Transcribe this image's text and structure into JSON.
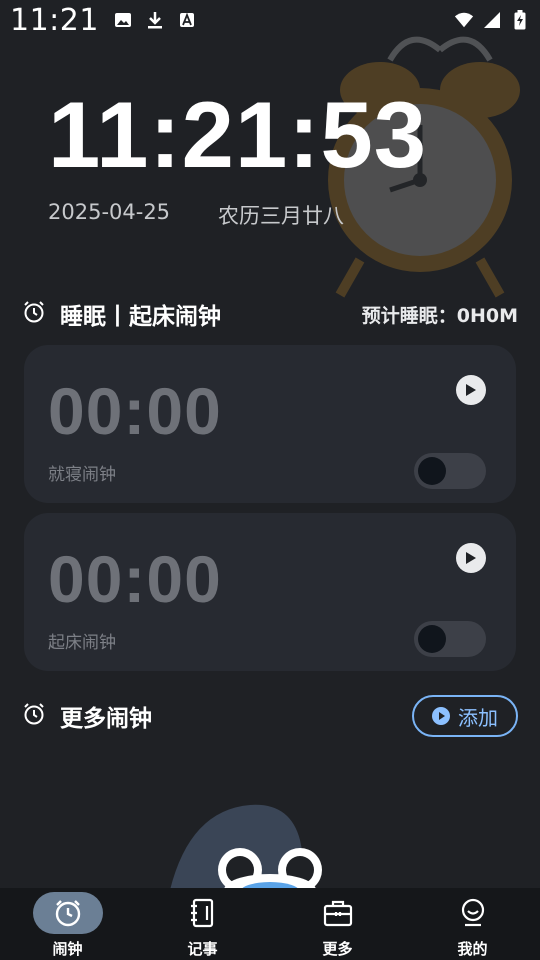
{
  "status_bar": {
    "time": "11:21",
    "left_icons": [
      "image-icon",
      "download-icon",
      "font-icon"
    ],
    "right_icons": [
      "wifi-icon",
      "signal-icon",
      "battery-icon"
    ]
  },
  "clock": {
    "time": "11:21:53",
    "date": "2025-04-25",
    "lunar": "农历三月廿八"
  },
  "sleep_section": {
    "title": "睡眠丨起床闹钟",
    "estimate": "预计睡眠：0H0M",
    "cards": [
      {
        "time": "00:00",
        "label": "就寝闹钟",
        "enabled": false
      },
      {
        "time": "00:00",
        "label": "起床闹钟",
        "enabled": false
      }
    ]
  },
  "more_section": {
    "title": "更多闹钟",
    "add_label": "添加"
  },
  "tabs": [
    {
      "label": "闹钟",
      "icon": "alarm-icon",
      "active": true
    },
    {
      "label": "记事",
      "icon": "notebook-icon",
      "active": false
    },
    {
      "label": "更多",
      "icon": "toolbox-icon",
      "active": false
    },
    {
      "label": "我的",
      "icon": "profile-icon",
      "active": false
    }
  ],
  "colors": {
    "background": "#1f2125",
    "card": "#272a31",
    "accent": "#7ab4f6",
    "active_tab": "#6b7f95"
  }
}
